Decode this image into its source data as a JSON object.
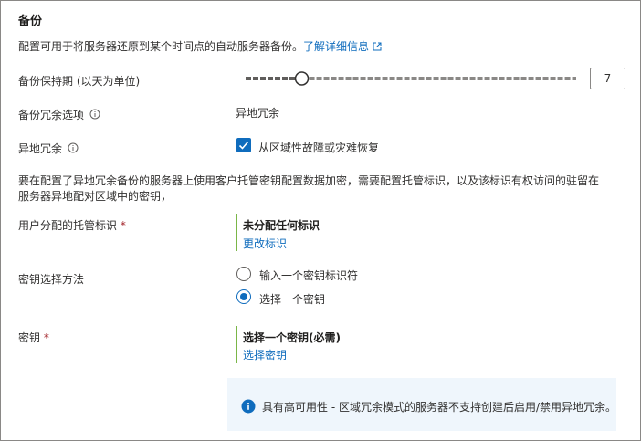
{
  "section": {
    "title": "备份",
    "description": "配置可用于将服务器还原到某个时间点的自动服务器备份。",
    "learn_more": "了解详细信息"
  },
  "retention": {
    "label": "备份保持期 (以天为单位)",
    "value": "7",
    "level_fraction": 0.17
  },
  "redundancy": {
    "label": "备份冗余选项",
    "value": "异地冗余"
  },
  "geo": {
    "label": "异地冗余",
    "checkbox_label": "从区域性故障或灾难恢复",
    "checked": true
  },
  "cmk_note_line1": "要在配置了异地冗余备份的服务器上使用客户托管密钥配置数据加密，需要配置托管标识，以及该标识有权访问的驻留在",
  "cmk_note_line2": "服务器异地配对区域中的密钥，",
  "identity": {
    "label": "用户分配的托管标识",
    "required": "*",
    "value": "未分配任何标识",
    "action": "更改标识"
  },
  "key_method": {
    "label": "密钥选择方法",
    "options": [
      "输入一个密钥标识符",
      "选择一个密钥"
    ],
    "selected_index": 1
  },
  "key": {
    "label": "密钥",
    "required": "*",
    "value": "选择一个密钥(必需)",
    "action": "选择密钥"
  },
  "notice": {
    "text": "具有高可用性 - 区域冗余模式的服务器不支持创建后启用/禁用异地冗余。"
  },
  "colors": {
    "accent": "#0f6cbd",
    "required": "#a4262c",
    "success_bar": "#7ab648",
    "notice_bg": "#eff6fc"
  }
}
